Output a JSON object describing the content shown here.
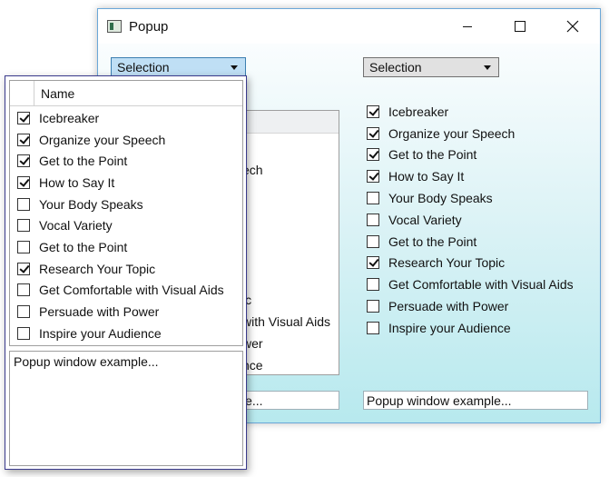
{
  "window": {
    "title": "Popup"
  },
  "left_panel": {
    "selection_label": "Selection",
    "partial_rows": [
      {
        "text": "ech"
      },
      {
        "text": "ic"
      },
      {
        "text": "with Visual Aids"
      },
      {
        "text": "wer"
      },
      {
        "text": "nce"
      }
    ],
    "textbox_partial": "le..."
  },
  "right_panel": {
    "selection_label": "Selection",
    "items": [
      {
        "label": "Icebreaker",
        "checked": true
      },
      {
        "label": "Organize your Speech",
        "checked": true
      },
      {
        "label": "Get to the Point",
        "checked": true
      },
      {
        "label": "How to Say It",
        "checked": true
      },
      {
        "label": "Your Body Speaks",
        "checked": false
      },
      {
        "label": "Vocal Variety",
        "checked": false
      },
      {
        "label": "Get to the Point",
        "checked": false
      },
      {
        "label": "Research Your Topic",
        "checked": true
      },
      {
        "label": "Get Comfortable with Visual Aids",
        "checked": false
      },
      {
        "label": "Persuade with Power",
        "checked": false
      },
      {
        "label": "Inspire your Audience",
        "checked": false
      }
    ],
    "textbox_value": "Popup window example..."
  },
  "popup": {
    "column_header": "Name",
    "items": [
      {
        "label": "Icebreaker",
        "checked": true
      },
      {
        "label": "Organize your Speech",
        "checked": true
      },
      {
        "label": "Get to the Point",
        "checked": true
      },
      {
        "label": "How to Say It",
        "checked": true
      },
      {
        "label": "Your Body Speaks",
        "checked": false
      },
      {
        "label": "Vocal Variety",
        "checked": false
      },
      {
        "label": "Get to the Point",
        "checked": false
      },
      {
        "label": "Research Your Topic",
        "checked": true
      },
      {
        "label": "Get Comfortable with Visual Aids",
        "checked": false
      },
      {
        "label": "Persuade with Power",
        "checked": false
      },
      {
        "label": "Inspire your Audience",
        "checked": false
      }
    ],
    "text": "Popup window example..."
  },
  "colors": {
    "left_combo_bg": "#bfdff5",
    "right_combo_bg": "#e1e1e1",
    "gradient_bottom": "#b7e9ee"
  },
  "icons": [
    "app-icon",
    "minimize-icon",
    "maximize-icon",
    "close-icon",
    "chevron-down-icon",
    "checkbox-icon"
  ]
}
